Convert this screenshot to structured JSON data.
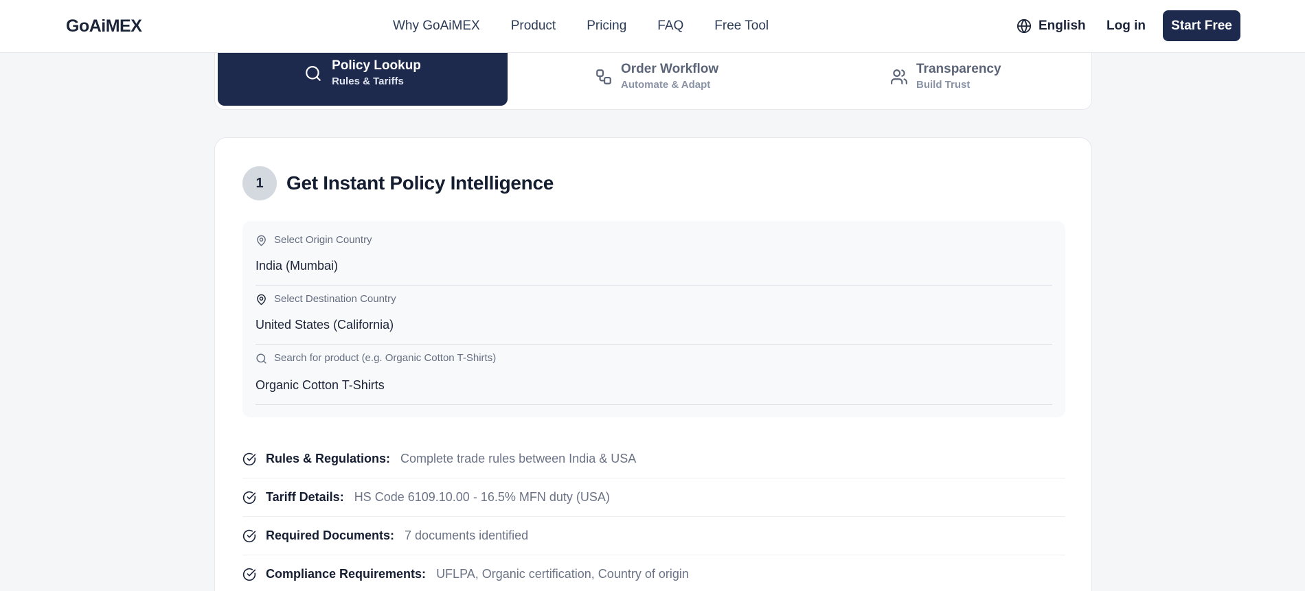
{
  "header": {
    "logo": "GoAiMEX",
    "nav": [
      "Why GoAiMEX",
      "Product",
      "Pricing",
      "FAQ",
      "Free Tool"
    ],
    "language": "English",
    "login": "Log in",
    "cta": "Start Free"
  },
  "tabs": [
    {
      "title": "Policy Lookup",
      "subtitle": "Rules & Tariffs",
      "icon": "search-icon",
      "active": true
    },
    {
      "title": "Order Workflow",
      "subtitle": "Automate & Adapt",
      "icon": "workflow-icon",
      "active": false
    },
    {
      "title": "Transparency",
      "subtitle": "Build Trust",
      "icon": "users-icon",
      "active": false
    }
  ],
  "step": {
    "number": "1",
    "title": "Get Instant Policy Intelligence"
  },
  "form": {
    "origin": {
      "label": "Select Origin Country",
      "value": "India (Mumbai)"
    },
    "destination": {
      "label": "Select Destination Country",
      "value": "United States (California)"
    },
    "product": {
      "label": "Search for product (e.g. Organic Cotton T-Shirts)",
      "value": "Organic Cotton T-Shirts"
    }
  },
  "features": [
    {
      "label": "Rules & Regulations:",
      "value": "Complete trade rules between India & USA"
    },
    {
      "label": "Tariff Details:",
      "value": "HS Code 6109.10.00 - 16.5% MFN duty (USA)"
    },
    {
      "label": "Required Documents:",
      "value": "7 documents identified"
    },
    {
      "label": "Compliance Requirements:",
      "value": "UFLPA, Organic certification, Country of origin"
    }
  ],
  "colors": {
    "navy": "#1d2a4e",
    "accent": "#f4a623",
    "background": "#f5f6f8"
  }
}
